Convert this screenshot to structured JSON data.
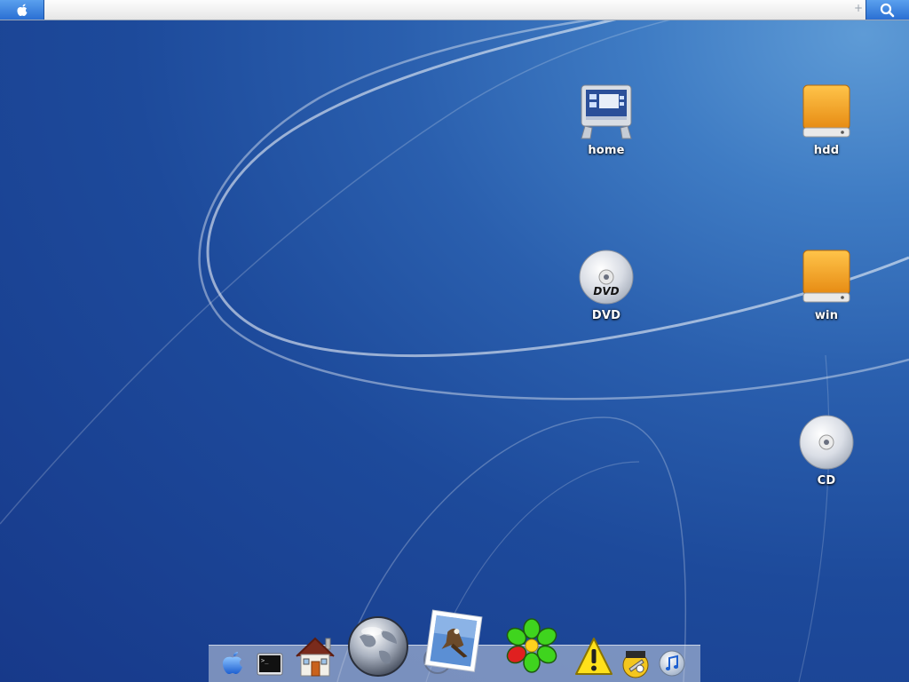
{
  "menubar": {
    "apple_icon": "apple-icon",
    "search_icon": "magnifier-icon",
    "plus_glyph": "+"
  },
  "desktop": {
    "icons": [
      {
        "label": "home",
        "icon": "computer-monitor-icon"
      },
      {
        "label": "hdd",
        "icon": "hard-drive-icon"
      },
      {
        "label": "DVD",
        "icon": "dvd-disc-icon"
      },
      {
        "label": "win",
        "icon": "hard-drive-icon"
      },
      {
        "label": "CD",
        "icon": "cd-disc-icon"
      }
    ],
    "dvd_disc_text": "DVD"
  },
  "dock": {
    "items": [
      {
        "icon": "apple-finder-icon"
      },
      {
        "icon": "terminal-icon"
      },
      {
        "icon": "home-house-icon"
      },
      {
        "icon": "globe-browser-icon"
      },
      {
        "icon": "mail-stamp-icon"
      },
      {
        "icon": "icq-flower-icon"
      },
      {
        "icon": "warning-console-icon"
      },
      {
        "icon": "tool-utility-icon"
      },
      {
        "icon": "itunes-disc-icon"
      }
    ],
    "terminal_prompt": ">_"
  },
  "colors": {
    "menubar_accent": "#2a6fd3",
    "desktop_blue": "#1d4a9b",
    "drive_orange": "#f0a020"
  }
}
